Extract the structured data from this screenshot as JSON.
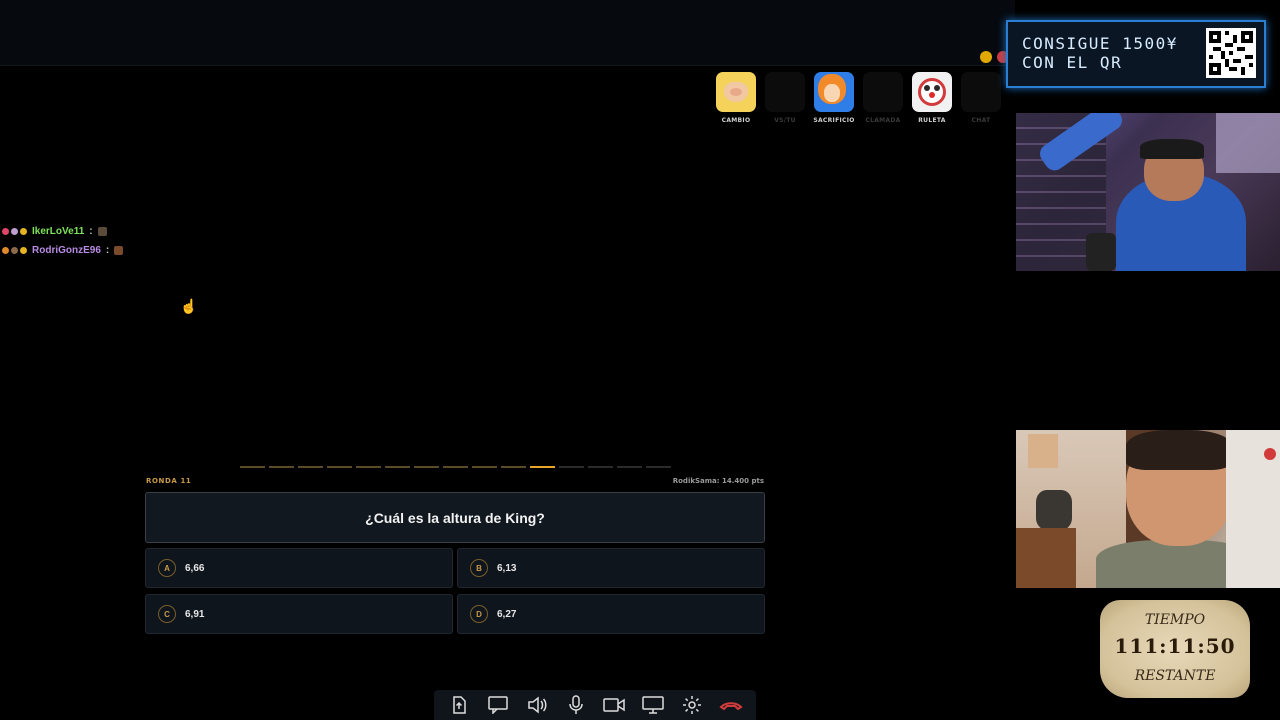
{
  "window_controls": {
    "minimize_color": "#e0a800",
    "close_color": "#d23b3b"
  },
  "powerups": [
    {
      "label": "CAMBIO",
      "state": "active"
    },
    {
      "label": "VS/TU",
      "state": "disabled"
    },
    {
      "label": "SACRIFICIO",
      "state": "active"
    },
    {
      "label": "CLAMADA",
      "state": "disabled"
    },
    {
      "label": "RULETA",
      "state": "active"
    },
    {
      "label": "CHAT",
      "state": "disabled"
    }
  ],
  "chat": [
    {
      "user": "IkerLoVe11",
      "separator": ":",
      "user_color": "#7de35a"
    },
    {
      "user": "RodriGonzE96",
      "separator": ":",
      "user_color": "#b98ce3"
    }
  ],
  "quiz": {
    "round_label": "RONDA 11",
    "score_label": "RodikSama: 14.400 pts",
    "question": "¿Cuál es la altura de King?",
    "progress": {
      "total_segments": 15,
      "current_segment": 11
    },
    "answers": [
      {
        "letter": "A",
        "value": "6,66"
      },
      {
        "letter": "B",
        "value": "6,13"
      },
      {
        "letter": "C",
        "value": "6,91"
      },
      {
        "letter": "D",
        "value": "6,27"
      }
    ]
  },
  "toolbar": {
    "icons": [
      "share-icon",
      "chat-icon",
      "volume-icon",
      "microphone-icon",
      "camera-icon",
      "screen-share-icon",
      "gear-icon",
      "hang-up-icon"
    ],
    "hang_up_color": "#d23b3b"
  },
  "promo": {
    "line1": "CONSIGUE 1500¥",
    "line2": "CON EL QR",
    "border_color": "#2a7fd2"
  },
  "timer": {
    "label_top": "TIEMPO",
    "time": "111:11:50",
    "label_bottom": "RESTANTE"
  }
}
